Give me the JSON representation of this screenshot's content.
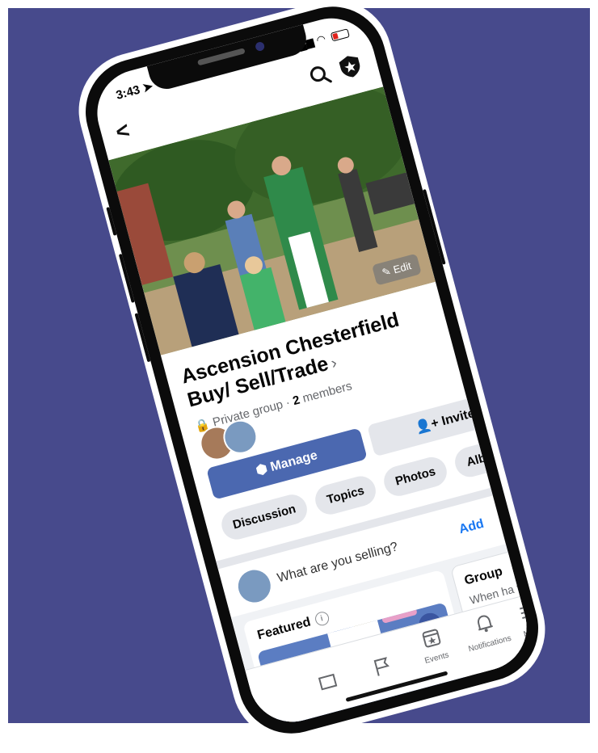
{
  "status_bar": {
    "time": "3:43"
  },
  "header": {
    "back": "<"
  },
  "cover": {
    "edit_label": "Edit"
  },
  "group": {
    "title": "Ascension Chesterfield Buy/ Sell/Trade",
    "privacy": "Private group",
    "member_count": "2",
    "members_label": "members"
  },
  "actions": {
    "manage_label": "Manage",
    "invite_label": "Invite"
  },
  "tabs": [
    "Discussion",
    "Topics",
    "Photos",
    "Albums"
  ],
  "composer": {
    "placeholder": "What are you selling?",
    "add_label": "Add"
  },
  "featured": {
    "title": "Featured",
    "close": "×"
  },
  "group_card": {
    "title": "Group",
    "text": "When ha trendin"
  },
  "bottom_nav": {
    "events": "Events",
    "notifications": "Notifications",
    "menu": "Menu"
  },
  "colors": {
    "background": "#474a8c",
    "primary": "#4b68b0",
    "chip": "#e4e6eb",
    "link": "#1877f2"
  }
}
